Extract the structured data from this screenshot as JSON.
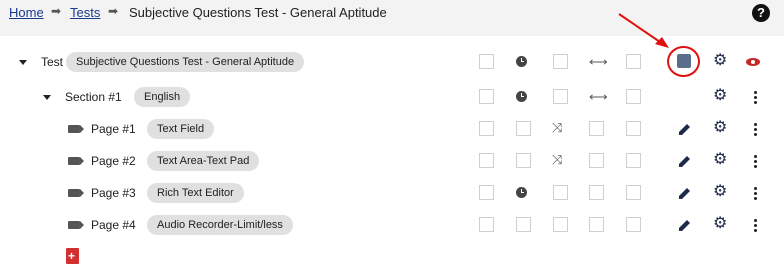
{
  "breadcrumb": {
    "home": "Home",
    "tests": "Tests",
    "current": "Subjective Questions Test - General Aptitude",
    "separator": "➡"
  },
  "help_symbol": "?",
  "tree": {
    "test": {
      "label": "Test",
      "chip": "Subjective Questions Test - General Aptitude"
    },
    "section": {
      "label": "Section #1",
      "chip": "English"
    },
    "pages": [
      {
        "label": "Page #1",
        "chip": "Text Field"
      },
      {
        "label": "Page #2",
        "chip": "Text Area-Text Pad"
      },
      {
        "label": "Page #3",
        "chip": "Rich Text Editor"
      },
      {
        "label": "Page #4",
        "chip": "Audio Recorder-Limit/less"
      }
    ]
  },
  "icons": {
    "arrows": "⟷",
    "shuffle": "⤨",
    "gear": "⚙"
  },
  "colors": {
    "annotation_red": "#e01010",
    "link": "#1a3a8f",
    "eye": "#c62828",
    "add_page": "#d32f2f"
  }
}
